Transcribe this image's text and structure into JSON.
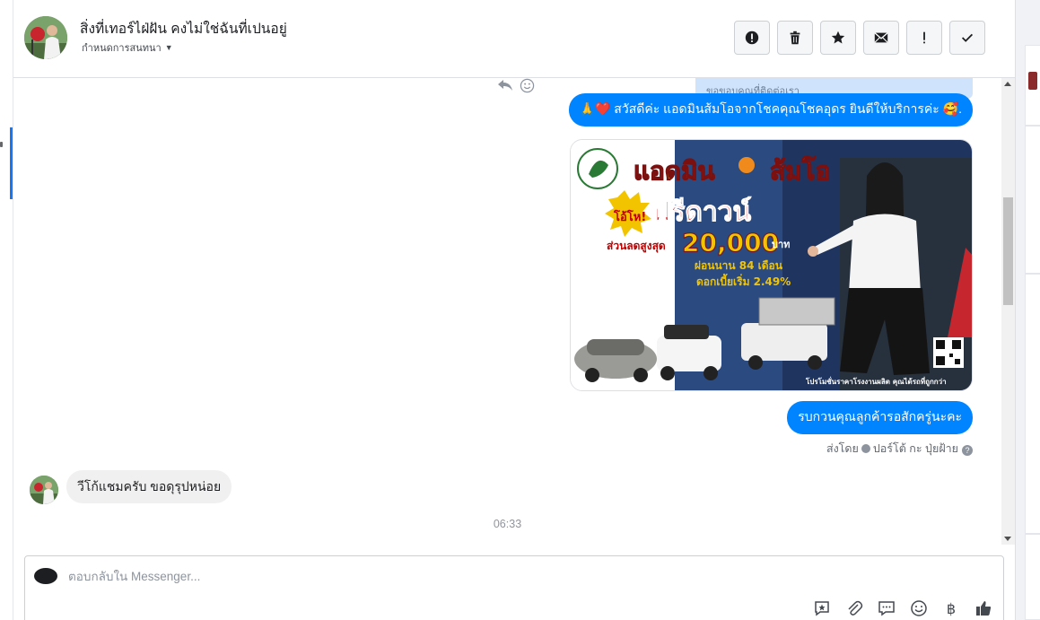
{
  "header": {
    "title": "สิ่งที่เทอร์ไฝ่ฝัน คงไม่ใช่ฉันที่เปนอยู่",
    "subtitle": "กำหนดการสนทนา",
    "actions": [
      "spam-icon",
      "trash-icon",
      "star-icon",
      "envelope-icon",
      "exclamation-icon",
      "check-icon"
    ]
  },
  "chat": {
    "quoted_text": "ขอขอบคุณที่ติดต่อเรา",
    "message_1": "🙏❤️ สวัสดีค่ะ แอดมินส้มโอจากโชคคุณโชคอุดร ยินดีให้บริการค่ะ 🥰.",
    "promo": {
      "headline": "แอดมิน",
      "headline2": "ส้มโอ",
      "badge": "โอ้โห!",
      "offer": "ฟรีดาวน์",
      "discount_label": "ส่วนลดสูงสุด",
      "discount_value": "20,000",
      "discount_unit": "บาท",
      "installment": "ผ่อนนาน 84 เดือน",
      "interest": "ดอกเบี้ยเริ่ม 2.49%",
      "footer": "โปรโมชั่นราคาโรงงานผลิต คุณได้รถที่ถูกกว่า"
    },
    "message_2": "รบกวนคุณลูกค้ารอสักครู่นะคะ",
    "sent_by_label": "ส่งโดย",
    "sender_name": "ปอร์โต้ กะ ปุ่ยฝ้าย",
    "incoming_message": "วีโก้แชมครับ ขอดุรุปหน่อย",
    "timestamp": "06:33"
  },
  "composer": {
    "placeholder": "ตอบกลับใน Messenger..."
  }
}
